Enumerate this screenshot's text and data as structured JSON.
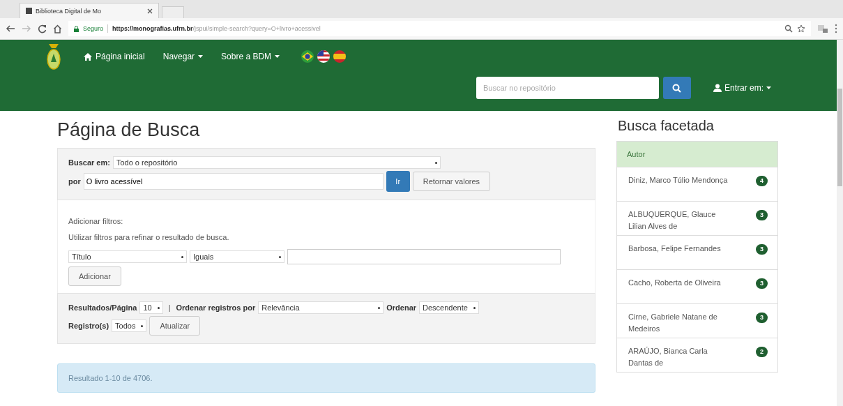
{
  "browser": {
    "tab_title": "Biblioteca Digital de Mo",
    "secure_label": "Seguro",
    "url_host": "https://monografias.ufrn.br",
    "url_path": "/jspui/simple-search?query=O+livro+acessivel"
  },
  "navbar": {
    "items": [
      {
        "label": "Página inicial",
        "kind": "home"
      },
      {
        "label": "Navegar",
        "kind": "dropdown"
      },
      {
        "label": "Sobre a BDM",
        "kind": "dropdown"
      }
    ],
    "search": {
      "placeholder": "Buscar no repositório"
    },
    "login": "Entrar em:"
  },
  "page_title": "Página de Busca",
  "search_form": {
    "scope_label": "Buscar em:",
    "scope_value": "Todo o repositório",
    "query_label": "por",
    "query_value": "O livro acessível",
    "go_button": "Ir",
    "reset_button": "Retornar valores"
  },
  "filters": {
    "heading": "Adicionar filtros:",
    "hint": "Utilizar filtros para refinar o resultado de busca.",
    "field": "Título",
    "operator": "Iguais",
    "add_button": "Adicionar"
  },
  "options": {
    "per_page_label": "Resultados/Página",
    "per_page": "10",
    "separator": "|",
    "sort_by_label": "Ordenar registros por",
    "sort_by": "Relevância",
    "order_label": "Ordenar",
    "order": "Descendente",
    "records_label": "Registro(s)",
    "records": "Todos",
    "update_button": "Atualizar"
  },
  "results": {
    "summary": "Resultado 1-10 de 4706."
  },
  "facets": {
    "title": "Busca facetada",
    "heading": "Autor",
    "items": [
      {
        "name": "Diniz, Marco Túlio Mendonça",
        "count": "4"
      },
      {
        "name": "ALBUQUERQUE, Glauce Lilian Alves de",
        "count": "3"
      },
      {
        "name": "Barbosa, Felipe Fernandes",
        "count": "3"
      },
      {
        "name": "Cacho, Roberta de Oliveira",
        "count": "3"
      },
      {
        "name": "Cirne, Gabriele Natane de Medeiros",
        "count": "3"
      },
      {
        "name": "ARAÚJO, Bianca Carla Dantas de",
        "count": "2"
      }
    ]
  }
}
